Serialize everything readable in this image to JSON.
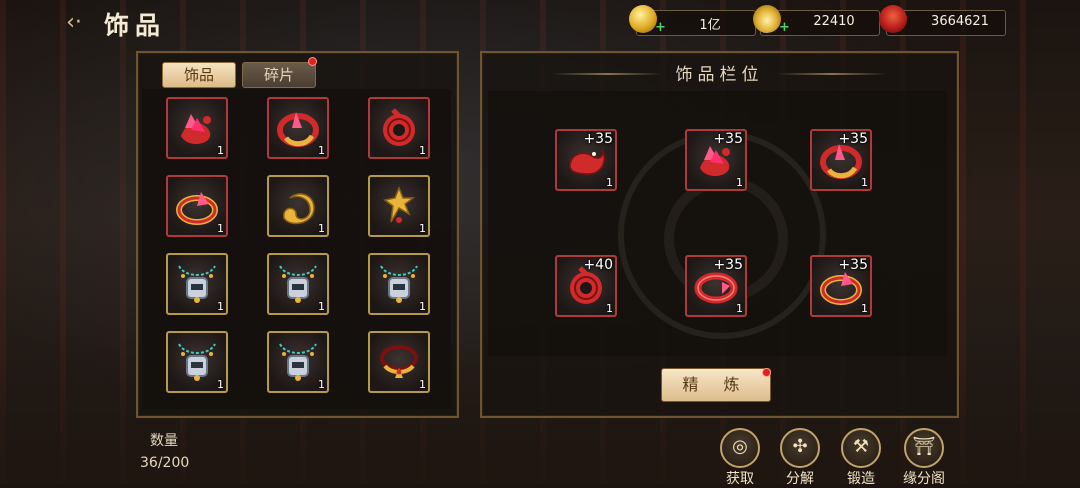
{
  "header": {
    "title": "饰品",
    "currencies": [
      {
        "name": "gold-coin",
        "value": "1亿"
      },
      {
        "name": "gold-ingot",
        "value": "22410"
      },
      {
        "name": "red-bag",
        "value": "3664621"
      }
    ]
  },
  "left": {
    "tabs": [
      {
        "label": "饰品"
      },
      {
        "label": "碎片"
      }
    ],
    "items": [
      {
        "icon": "red-crystal-bracelet-icon",
        "count": "1"
      },
      {
        "icon": "crimson-ring-icon",
        "count": "1"
      },
      {
        "icon": "red-jade-disc-icon",
        "count": "1"
      },
      {
        "icon": "gold-red-ring-icon",
        "count": "1"
      },
      {
        "icon": "gold-cloud-charm-icon",
        "count": "1"
      },
      {
        "icon": "gold-flame-charm-icon",
        "count": "1"
      },
      {
        "icon": "silver-necklace-icon",
        "count": "1"
      },
      {
        "icon": "silver-necklace-icon",
        "count": "1"
      },
      {
        "icon": "silver-necklace-icon",
        "count": "1"
      },
      {
        "icon": "silver-necklace-icon",
        "count": "1"
      },
      {
        "icon": "silver-necklace-icon",
        "count": "1"
      },
      {
        "icon": "gold-torque-necklace-icon",
        "count": "1"
      }
    ],
    "quantity_label": "数量",
    "quantity_value": "36/200"
  },
  "right": {
    "title": "饰品栏位",
    "slots": [
      {
        "icon": "red-dragon-ring-icon",
        "level": "+35",
        "count": "1"
      },
      {
        "icon": "red-crystal-bracelet-icon",
        "level": "+35",
        "count": "1"
      },
      {
        "icon": "crimson-ring-icon",
        "level": "+35",
        "count": "1"
      },
      {
        "icon": "red-jade-disc-icon",
        "level": "+40",
        "count": "1"
      },
      {
        "icon": "red-bangle-icon",
        "level": "+35",
        "count": "1"
      },
      {
        "icon": "gold-red-ring-icon",
        "level": "+35",
        "count": "1"
      }
    ],
    "refine_label": "精 炼"
  },
  "actions": [
    {
      "label": "获取",
      "icon": "obtain-icon",
      "glyph": "◎"
    },
    {
      "label": "分解",
      "icon": "decompose-icon",
      "glyph": "✣"
    },
    {
      "label": "锻造",
      "icon": "hammer-icon",
      "glyph": "⚒"
    },
    {
      "label": "缘分阁",
      "icon": "pavilion-icon",
      "glyph": "⛩"
    }
  ],
  "colors": {
    "red_border": "#b03a3a",
    "gold_border": "#b79a47",
    "accent": "#dcbb88"
  }
}
